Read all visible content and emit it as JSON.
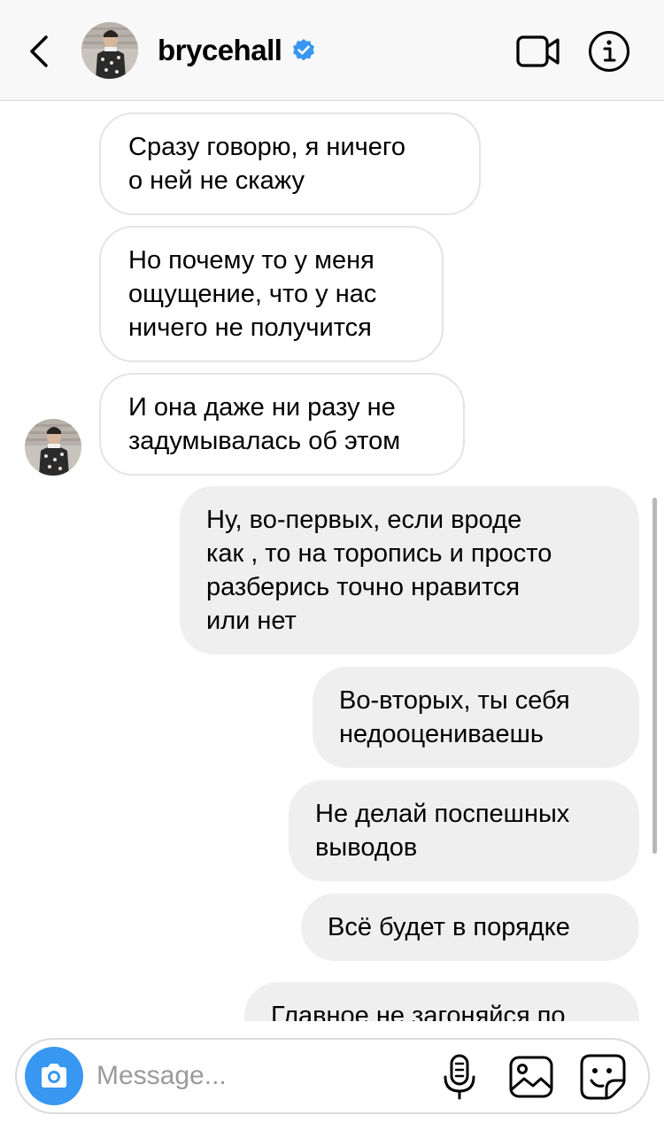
{
  "header": {
    "username": "brycehall",
    "back_icon": "chevron-left-icon",
    "verified_icon": "verified-badge-icon",
    "video_icon": "video-camera-icon",
    "info_icon": "info-icon",
    "verified_color": "#3897f0"
  },
  "messages": [
    {
      "direction": "incoming",
      "text": "Сразу говорю, я ничего\nо ней не скажу"
    },
    {
      "direction": "incoming",
      "text": "Но почему то у меня\nощущение, что у нас\nничего не получится"
    },
    {
      "direction": "incoming",
      "text": "И она даже ни разу не\nзадумывалась об этом"
    },
    {
      "direction": "outgoing",
      "text": "Ну, во-первых, если вроде\nкак , то на торопись и просто\nразберись точно нравится\nили нет"
    },
    {
      "direction": "outgoing",
      "text": "Во-вторых, ты себя\nнедооцениваешь"
    },
    {
      "direction": "outgoing",
      "text": "Не делай поспешных\nвыводов"
    },
    {
      "direction": "outgoing",
      "text": "Всё будет в порядке"
    },
    {
      "direction": "outgoing",
      "text": "Главное не загоняйся по"
    }
  ],
  "composer": {
    "placeholder": "Message...",
    "camera_icon": "camera-icon",
    "mic_icon": "microphone-icon",
    "gallery_icon": "gallery-icon",
    "sticker_icon": "sticker-icon",
    "accent_color": "#3897f0"
  }
}
